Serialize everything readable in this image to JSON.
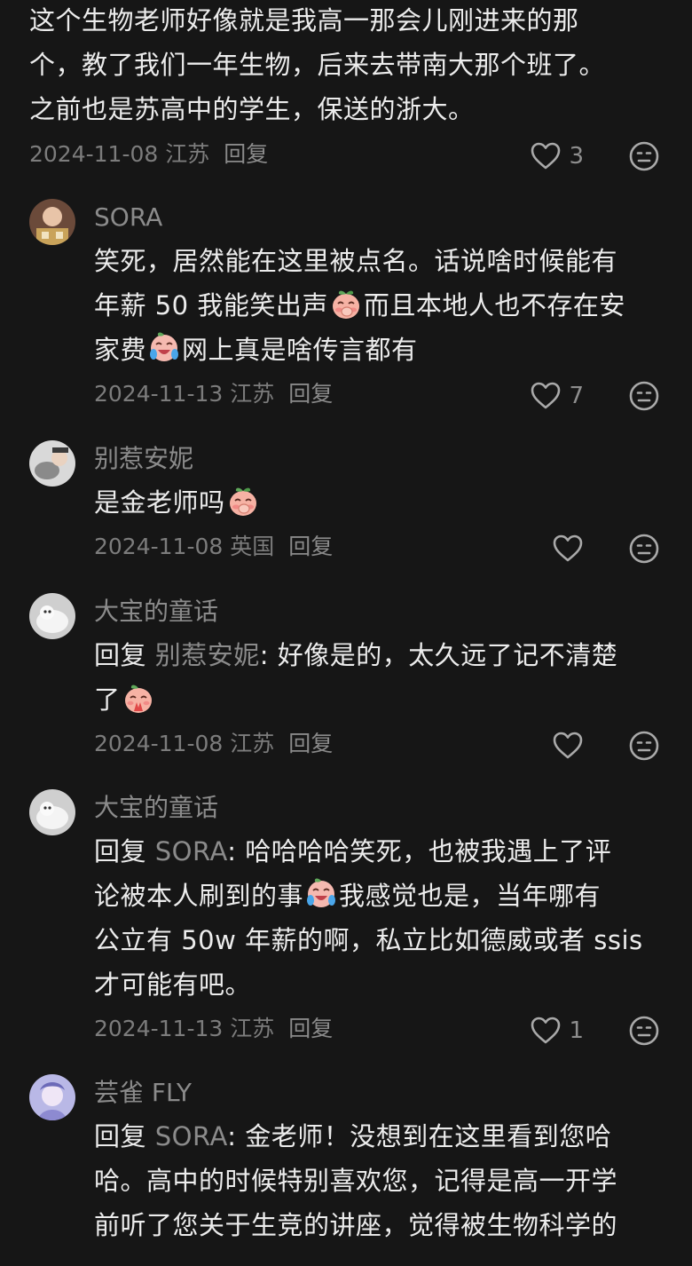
{
  "comments": [
    {
      "body_lines": [
        "这个生物老师好像就是我高一那会儿刚进来的那",
        "个，教了我们一年生物，后来去带南大那个班了。",
        "之前也是苏高中的学生，保送的浙大。"
      ],
      "date": "2024-11-08",
      "location": "江苏",
      "reply_label": "回复",
      "likes": "3"
    },
    {
      "author": "SORA",
      "body_parts": [
        "笑死，居然能在这里被点名。话说啥时候能有",
        "年薪 50 我能笑出声",
        "而且本地人也不存在安",
        "家费",
        "网上真是啥传言都有"
      ],
      "date": "2024-11-13",
      "location": "江苏",
      "reply_label": "回复",
      "likes": "7"
    },
    {
      "author": "别惹安妮",
      "body_parts": [
        "是金老师吗"
      ],
      "date": "2024-11-08",
      "location": "英国",
      "reply_label": "回复",
      "likes": ""
    },
    {
      "author": "大宝的童话",
      "reply_prefix": "回复",
      "reply_target": "别惹安妮",
      "body_parts": [
        ": 好像是的，太久远了记不清楚",
        "了"
      ],
      "date": "2024-11-08",
      "location": "江苏",
      "reply_label": "回复",
      "likes": ""
    },
    {
      "author": "大宝的童话",
      "reply_prefix": "回复",
      "reply_target": "SORA",
      "body_parts": [
        ": 哈哈哈哈笑死，也被我遇上了评",
        "论被本人刷到的事",
        "我感觉也是，当年哪有",
        "公立有 50w 年薪的啊，私立比如德威或者 ssis",
        "才可能有吧。"
      ],
      "date": "2024-11-13",
      "location": "江苏",
      "reply_label": "回复",
      "likes": "1"
    },
    {
      "author": "芸雀 FLY",
      "reply_prefix": "回复",
      "reply_target": "SORA",
      "body_parts": [
        ": 金老师！没想到在这里看到您哈",
        "哈。高中的时候特别喜欢您，记得是高一开学",
        "前听了您关于生竞的讲座，觉得被生物科学的"
      ]
    }
  ],
  "icons": {
    "like": "heart-outline-icon",
    "dislike": "meh-face-icon",
    "emoji_peach_shy": "peach-cover-mouth-emoji",
    "emoji_laugh_cry": "laugh-cry-emoji",
    "emoji_peach_pray": "peach-pray-emoji"
  },
  "colors": {
    "background": "#161616",
    "text": "#ececec",
    "muted": "#8b8b8b"
  }
}
